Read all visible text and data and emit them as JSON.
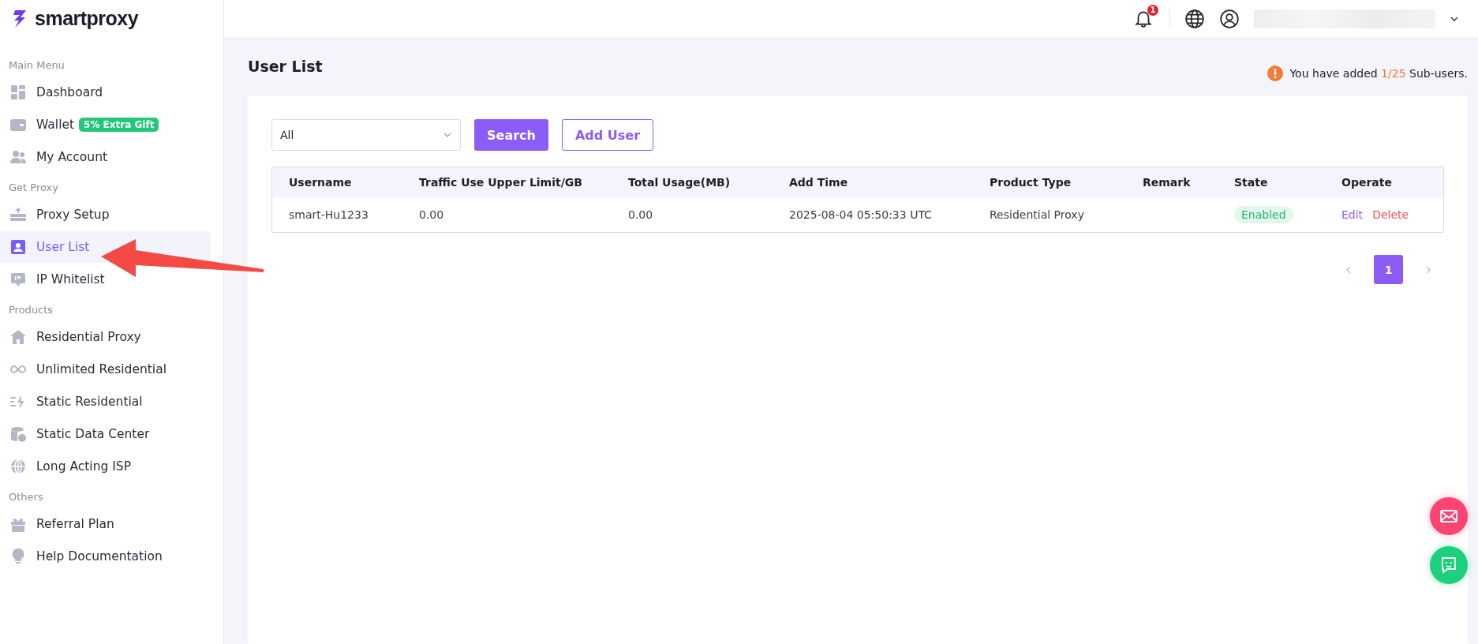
{
  "logo": {
    "text": "smartproxy"
  },
  "header": {
    "notification_count": "1"
  },
  "sidebar": {
    "sections": [
      {
        "heading": "Main Menu",
        "items": [
          {
            "label": "Dashboard",
            "selected": false
          },
          {
            "label": "Wallet",
            "badge": "5% Extra Gift",
            "selected": false
          },
          {
            "label": "My Account",
            "selected": false
          }
        ]
      },
      {
        "heading": "Get Proxy",
        "items": [
          {
            "label": "Proxy Setup",
            "selected": false
          },
          {
            "label": "User List",
            "selected": true
          },
          {
            "label": "IP Whitelist",
            "selected": false
          }
        ]
      },
      {
        "heading": "Products",
        "items": [
          {
            "label": "Residential Proxy",
            "selected": false
          },
          {
            "label": "Unlimited Residential",
            "selected": false
          },
          {
            "label": "Static Residential",
            "selected": false
          },
          {
            "label": "Static Data Center",
            "selected": false
          },
          {
            "label": "Long Acting ISP",
            "selected": false
          }
        ]
      },
      {
        "heading": "Others",
        "items": [
          {
            "label": "Referral Plan",
            "selected": false
          },
          {
            "label": "Help Documentation",
            "selected": false
          }
        ]
      }
    ]
  },
  "page": {
    "title": "User List",
    "notice": {
      "before": "You have added",
      "count": "1/25",
      "after": "Sub-users."
    }
  },
  "filter": {
    "value": "All"
  },
  "buttons": [
    {
      "label": "Search",
      "kind": "primary"
    },
    {
      "label": "Add User",
      "kind": "outline"
    }
  ],
  "table": {
    "columns": [
      "Username",
      "Traffic Use Upper Limit/GB",
      "Total Usage(MB)",
      "Add Time",
      "Product Type",
      "Remark",
      "State",
      "Operate"
    ],
    "rows": [
      {
        "cells": [
          "smart-Hu1233",
          "0.00",
          "0.00",
          "2025-08-04 05:50:33 UTC",
          "Residential Proxy",
          ""
        ],
        "state": "Enabled",
        "enabled": true,
        "actions": [
          {
            "label": "Edit",
            "kind": "edit"
          },
          {
            "label": "Delete",
            "kind": "delete"
          }
        ]
      }
    ]
  },
  "pagination": {
    "pages": [
      {
        "label": "1",
        "selected": true
      }
    ]
  }
}
